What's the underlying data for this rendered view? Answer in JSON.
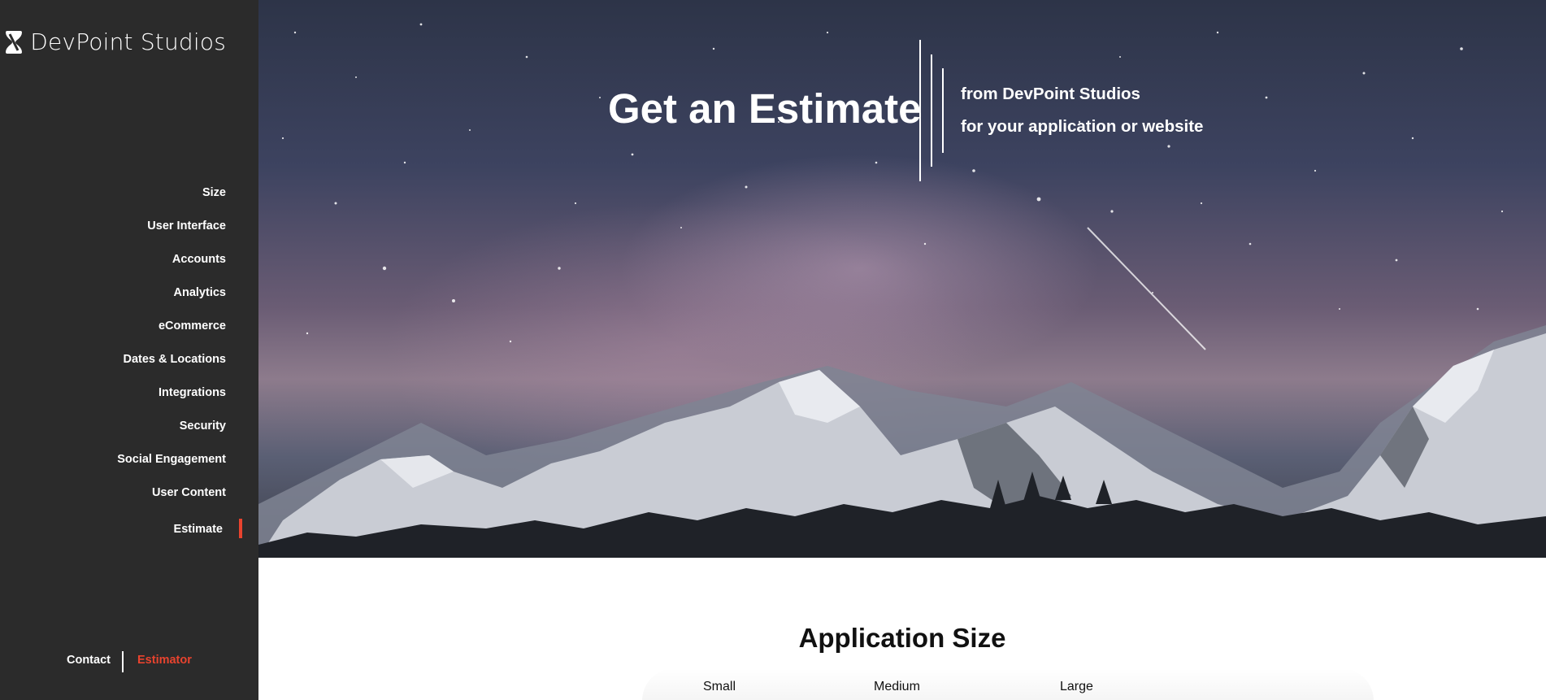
{
  "brand": {
    "name": "DevPoint Studios",
    "icon": "hourglass-logo-icon"
  },
  "sidebar": {
    "items": [
      {
        "label": "Size"
      },
      {
        "label": "User Interface"
      },
      {
        "label": "Accounts"
      },
      {
        "label": "Analytics"
      },
      {
        "label": "eCommerce"
      },
      {
        "label": "Dates & Locations"
      },
      {
        "label": "Integrations"
      },
      {
        "label": "Security"
      },
      {
        "label": "Social Engagement"
      },
      {
        "label": "User Content"
      },
      {
        "label": "Estimate",
        "active": true
      }
    ],
    "footer": {
      "contact_label": "Contact",
      "estimator_label": "Estimator"
    }
  },
  "hero": {
    "title": "Get an Estimate",
    "subtitle_line1": "from DevPoint Studios",
    "subtitle_line2": "for your application or website"
  },
  "application_size": {
    "title": "Application Size",
    "options": [
      "Small",
      "Medium",
      "Large"
    ]
  },
  "colors": {
    "sidebar_bg": "#2b2b2b",
    "accent": "#e8432e",
    "text_light": "#ffffff"
  }
}
